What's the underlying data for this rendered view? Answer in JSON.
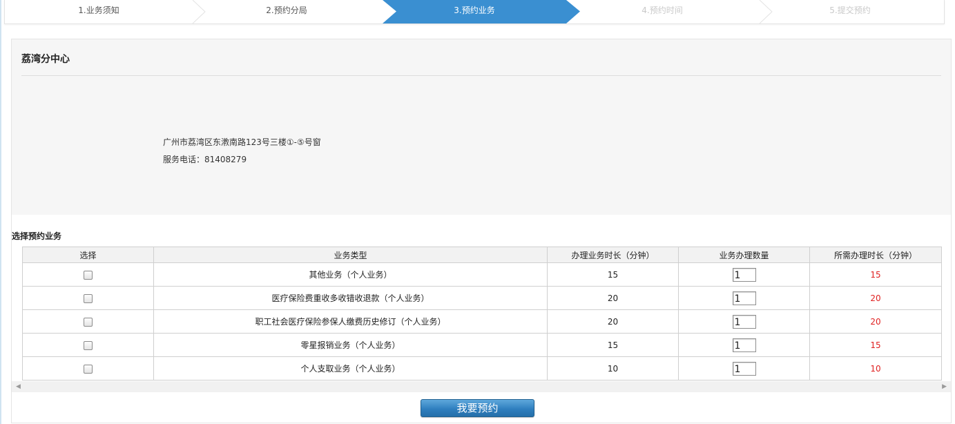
{
  "steps": [
    {
      "label": "1.业务须知",
      "state": "done"
    },
    {
      "label": "2.预约分局",
      "state": "done"
    },
    {
      "label": "3.预约业务",
      "state": "active"
    },
    {
      "label": "4.预约时间",
      "state": "disabled"
    },
    {
      "label": "5.提交预约",
      "state": "disabled"
    }
  ],
  "center": {
    "name": "荔湾分中心",
    "address": "广州市荔湾区东漖南路123号三楼①-⑤号窗",
    "phone": "服务电话：81408279"
  },
  "section_title": "选择预约业务",
  "table": {
    "headers": [
      "选择",
      "业务类型",
      "办理业务时长（分钟）",
      "业务办理数量",
      "所需办理时长（分钟）"
    ],
    "rows": [
      {
        "type": "其他业务（个人业务）",
        "duration": "15",
        "qty": "1",
        "total": "15",
        "checked": false
      },
      {
        "type": "医疗保险费重收多收错收退款（个人业务）",
        "duration": "20",
        "qty": "1",
        "total": "20",
        "checked": false
      },
      {
        "type": "职工社会医疗保险参保人缴费历史修订（个人业务）",
        "duration": "20",
        "qty": "1",
        "total": "20",
        "checked": false
      },
      {
        "type": "零星报销业务（个人业务）",
        "duration": "15",
        "qty": "1",
        "total": "15",
        "checked": false
      },
      {
        "type": "个人支取业务（个人业务）",
        "duration": "10",
        "qty": "1",
        "total": "10",
        "checked": false
      }
    ]
  },
  "submit_label": "我要预约",
  "colors": {
    "step_active": "#3a8fd1",
    "total_value": "#e02020",
    "button": "#2f7fbf"
  }
}
